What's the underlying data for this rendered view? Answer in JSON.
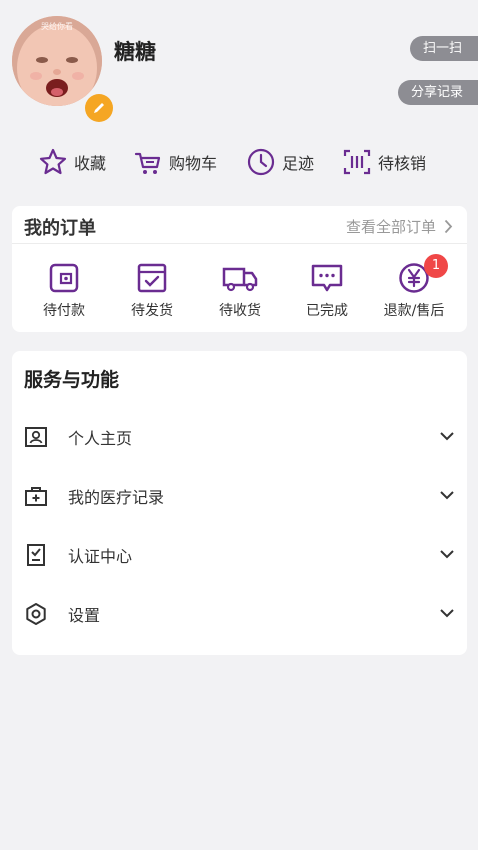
{
  "profile": {
    "avatar_caption": "哭给你看",
    "username": "糖糖"
  },
  "header_buttons": {
    "scan": "扫一扫",
    "share": "分享记录"
  },
  "quick_links": [
    {
      "label": "收藏",
      "icon": "star-icon"
    },
    {
      "label": "购物车",
      "icon": "cart-icon"
    },
    {
      "label": "足迹",
      "icon": "clock-icon"
    },
    {
      "label": "待核销",
      "icon": "barcode-icon"
    }
  ],
  "orders": {
    "title": "我的订单",
    "view_all": "查看全部订单",
    "items": [
      {
        "label": "待付款",
        "icon": "wallet-icon"
      },
      {
        "label": "待发货",
        "icon": "package-check-icon"
      },
      {
        "label": "待收货",
        "icon": "truck-icon"
      },
      {
        "label": "已完成",
        "icon": "message-dots-icon"
      },
      {
        "label": "退款/售后",
        "icon": "yuan-icon",
        "badge": "1"
      }
    ]
  },
  "services": {
    "title": "服务与功能",
    "items": [
      {
        "label": "个人主页",
        "icon": "profile-card-icon"
      },
      {
        "label": "我的医疗记录",
        "icon": "medical-kit-icon"
      },
      {
        "label": "认证中心",
        "icon": "checklist-icon"
      },
      {
        "label": "设置",
        "icon": "gear-icon"
      }
    ]
  },
  "colors": {
    "accent": "#6a2c91",
    "background": "#f2f2f4",
    "badge": "#f04747",
    "edit_badge": "#f5a623"
  }
}
